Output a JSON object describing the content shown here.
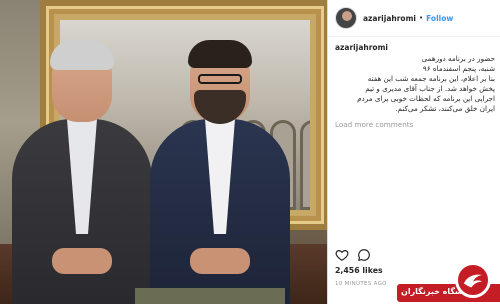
{
  "post": {
    "username": "azarijahromi",
    "follow_label": "Follow",
    "separator": "•",
    "caption_user": "azarijahromi",
    "caption_lines": [
      "حضور در برنامه دورهمی",
      "شنبه، پنجم اسفندماه ۹۶",
      "بنا بر اعلام، این برنامه جمعه شب این هفته",
      "پخش خواهد شد. از جناب آقای مدیری و تیم",
      "اجرایی این برنامه که لحظات خوبی برای مردم",
      "ایران خلق می‌کنند، تشکر می‌کنم."
    ],
    "load_more": "Load more comments",
    "likes": "2,456 likes",
    "time": "10 MINUTES AGO"
  },
  "icons": {
    "like": "heart-icon",
    "comment": "comment-icon"
  },
  "watermark": {
    "text": "باشگاه خبرنگاران"
  },
  "colors": {
    "follow": "#3897f0",
    "muted": "#999999",
    "text": "#262626",
    "brand_red": "#c41d26"
  }
}
